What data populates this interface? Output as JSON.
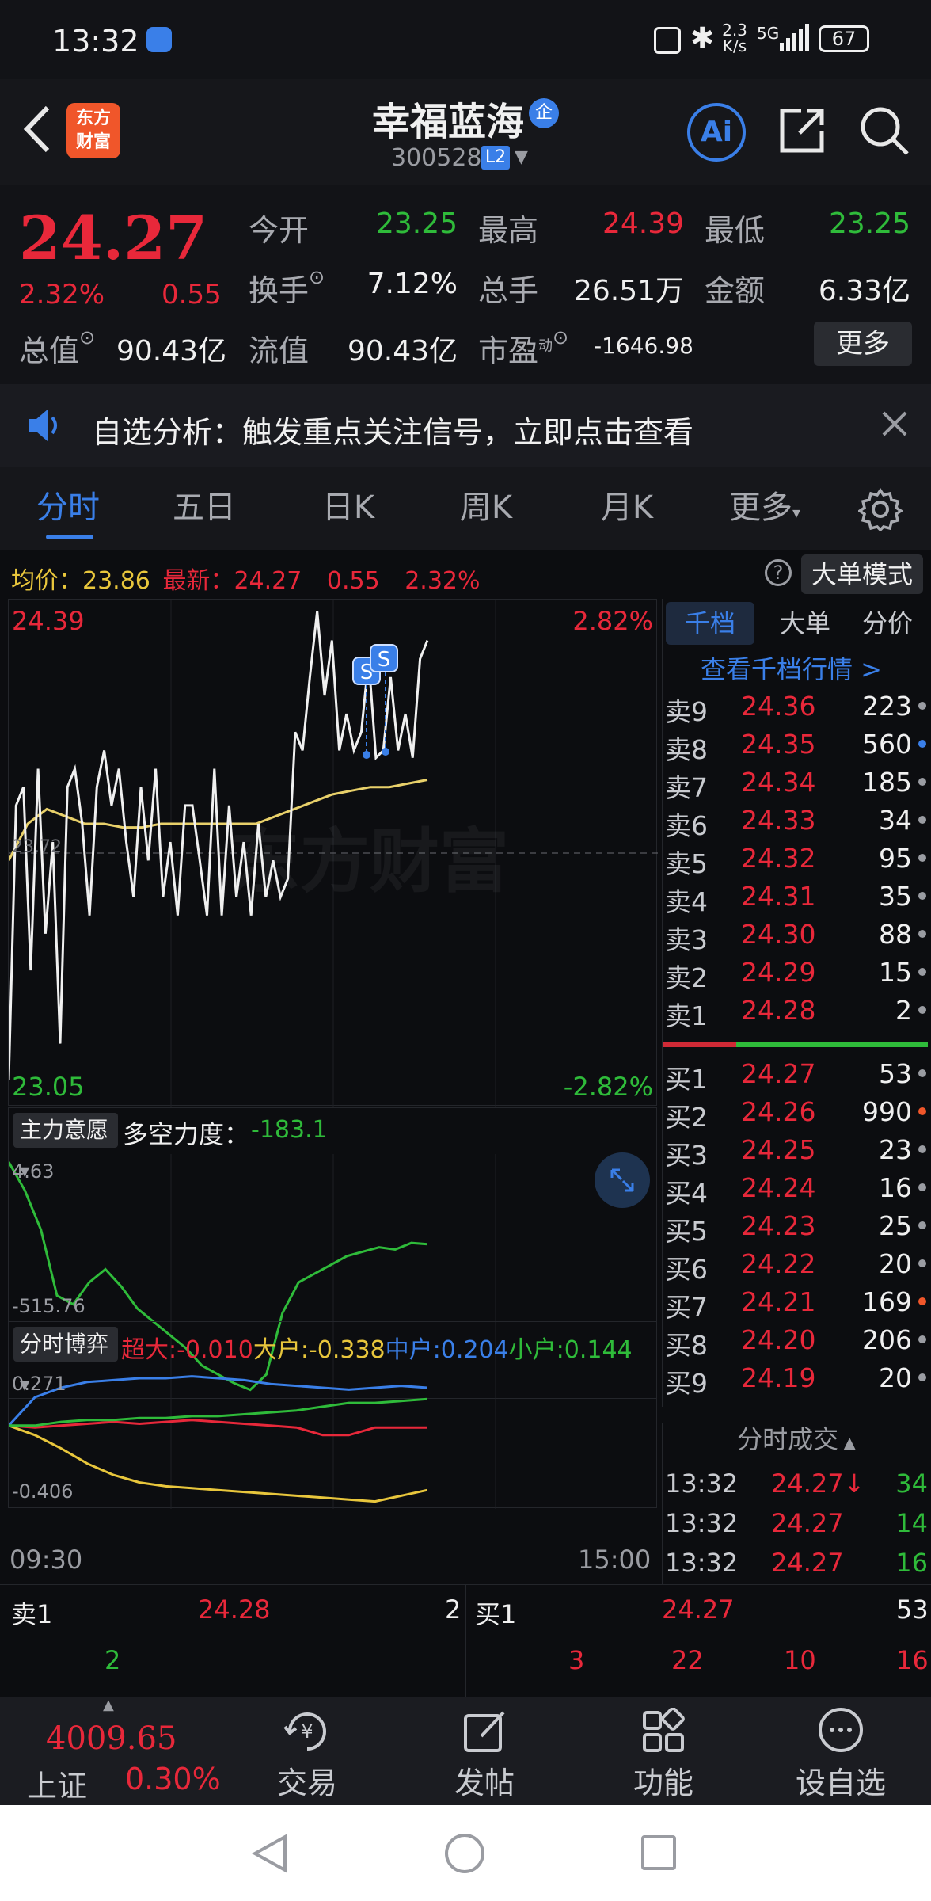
{
  "status": {
    "time": "13:32",
    "speed": "2.3",
    "speed_unit": "K/s",
    "network": "5G",
    "battery": "67"
  },
  "header": {
    "logo_line1": "东方",
    "logo_line2": "财富",
    "title": "幸福蓝海",
    "badge": "企",
    "code": "300528",
    "level": "L2",
    "ai": "Ai"
  },
  "quote": {
    "price": "24.27",
    "change_pct": "2.32%",
    "change": "0.55",
    "open_label": "今开",
    "open": "23.25",
    "high_label": "最高",
    "high": "24.39",
    "low_label": "最低",
    "low": "23.25",
    "turnover_label": "换手",
    "turnover": "7.12%",
    "volume_label": "总手",
    "volume": "26.51万",
    "amount_label": "金额",
    "amount": "6.33亿",
    "mktcap_label": "总值",
    "mktcap": "90.43亿",
    "float_label": "流值",
    "float": "90.43亿",
    "pe_label": "市盈",
    "pe_sup": "动",
    "pe": "-1646.98",
    "more": "更多"
  },
  "alert": {
    "text": "自选分析：触发重点关注信号，立即点击查看"
  },
  "tabs": [
    "分时",
    "五日",
    "日K",
    "周K",
    "月K",
    "更多"
  ],
  "chart_info": {
    "avg_label": "均价：",
    "avg": "23.86",
    "latest_label": "最新：",
    "latest": "24.27",
    "chg": "0.55",
    "pct": "2.32%",
    "mode_btn": "大单模式",
    "top_price": "24.39",
    "top_pct": "2.82%",
    "bottom_price": "23.05",
    "bottom_pct": "-2.82%",
    "mid_price": "23.72",
    "watermark": "东方财富"
  },
  "indicator1": {
    "select": "主力意愿",
    "label": "多空力度：",
    "value": "-183.1",
    "top": "4.63",
    "bottom": "-515.76"
  },
  "indicator2": {
    "select": "分时博弈",
    "xl_label": "超大",
    "xl": ":-0.010",
    "l_label": "大户",
    "l": ":-0.338",
    "m_label": "中户",
    "m": ":0.204",
    "s_label": "小户",
    "s": ":0.144",
    "top": "0.271",
    "bottom": "-0.406",
    "time_start": "09:30",
    "time_end": "15:00"
  },
  "chart_data": [
    {
      "type": "line",
      "title": "",
      "ylim": [
        23.05,
        24.39
      ],
      "x": [
        "09:30",
        "15:00"
      ],
      "series": [
        {
          "name": "",
          "values": [
            23.1,
            23.85,
            23.9,
            23.4,
            23.95,
            23.5,
            23.75,
            23.2,
            23.9,
            23.95,
            23.8,
            23.55,
            23.9,
            24.0,
            23.85,
            23.95,
            23.75,
            23.6,
            23.9,
            23.7,
            23.95,
            23.6,
            23.75,
            23.55,
            23.85,
            23.85,
            23.7,
            23.55,
            23.95,
            23.55,
            23.85,
            23.6,
            23.75,
            23.55,
            23.8,
            23.6,
            23.7,
            23.6,
            23.65,
            24.05,
            24.0,
            24.2,
            24.38,
            24.15,
            24.3,
            24.0,
            24.1,
            24.0,
            24.05,
            24.25,
            23.98,
            24.0,
            24.2,
            24.0,
            24.1,
            23.98,
            24.25,
            24.3
          ]
        },
        {
          "name": "",
          "values": [
            23.7,
            23.8,
            23.84,
            23.82,
            23.8,
            23.8,
            23.79,
            23.79,
            23.8,
            23.8,
            23.8,
            23.8,
            23.8,
            23.8,
            23.82,
            23.84,
            23.86,
            23.88,
            23.89,
            23.9,
            23.9,
            23.91,
            23.92
          ]
        }
      ]
    },
    {
      "type": "line",
      "title": "",
      "ylim": [
        -515.76,
        4.63
      ],
      "series": [
        {
          "name": "多空力度",
          "values": [
            4.63,
            -60,
            -150,
            -300,
            -320,
            -270,
            -240,
            -280,
            -330,
            -360,
            -390,
            -420,
            -460,
            -480,
            -500,
            -515,
            -480,
            -340,
            -270,
            -250,
            -230,
            -210,
            -200,
            -190,
            -195,
            -180,
            -183
          ]
        }
      ]
    },
    {
      "type": "line",
      "title": "",
      "ylim": [
        -0.406,
        0.271
      ],
      "series": [
        {
          "name": "超大",
          "values": [
            0.0,
            -0.01,
            0.0,
            0.01,
            0.02,
            0.01,
            0.02,
            0.03,
            0.02,
            0.01,
            0.0,
            -0.01,
            -0.05,
            -0.05,
            -0.01,
            -0.01,
            -0.01
          ]
        },
        {
          "name": "大户",
          "values": [
            0.0,
            -0.05,
            -0.12,
            -0.2,
            -0.26,
            -0.3,
            -0.32,
            -0.33,
            -0.34,
            -0.35,
            -0.36,
            -0.37,
            -0.38,
            -0.39,
            -0.4,
            -0.37,
            -0.34
          ]
        },
        {
          "name": "中户",
          "values": [
            0.0,
            0.15,
            0.2,
            0.23,
            0.24,
            0.25,
            0.25,
            0.26,
            0.25,
            0.24,
            0.22,
            0.21,
            0.2,
            0.19,
            0.2,
            0.21,
            0.2
          ]
        },
        {
          "name": "小户",
          "values": [
            0.0,
            0.0,
            0.02,
            0.03,
            0.03,
            0.04,
            0.04,
            0.05,
            0.05,
            0.06,
            0.07,
            0.08,
            0.1,
            0.12,
            0.12,
            0.13,
            0.14
          ]
        }
      ]
    }
  ],
  "orderbook": {
    "tabs": [
      "千档",
      "大单",
      "分价"
    ],
    "link": "查看千档行情 >",
    "asks": [
      {
        "l": "卖9",
        "p": "24.36",
        "v": "223"
      },
      {
        "l": "卖8",
        "p": "24.35",
        "v": "560"
      },
      {
        "l": "卖7",
        "p": "24.34",
        "v": "185"
      },
      {
        "l": "卖6",
        "p": "24.33",
        "v": "34"
      },
      {
        "l": "卖5",
        "p": "24.32",
        "v": "95"
      },
      {
        "l": "卖4",
        "p": "24.31",
        "v": "35"
      },
      {
        "l": "卖3",
        "p": "24.30",
        "v": "88"
      },
      {
        "l": "卖2",
        "p": "24.29",
        "v": "15"
      },
      {
        "l": "卖1",
        "p": "24.28",
        "v": "2"
      }
    ],
    "bids": [
      {
        "l": "买1",
        "p": "24.27",
        "v": "53"
      },
      {
        "l": "买2",
        "p": "24.26",
        "v": "990"
      },
      {
        "l": "买3",
        "p": "24.25",
        "v": "23"
      },
      {
        "l": "买4",
        "p": "24.24",
        "v": "16"
      },
      {
        "l": "买5",
        "p": "24.23",
        "v": "25"
      },
      {
        "l": "买6",
        "p": "24.22",
        "v": "20"
      },
      {
        "l": "买7",
        "p": "24.21",
        "v": "169"
      },
      {
        "l": "买8",
        "p": "24.20",
        "v": "206"
      },
      {
        "l": "买9",
        "p": "24.19",
        "v": "20"
      }
    ],
    "trades_title": "分时成交",
    "trades": [
      {
        "t": "13:32",
        "p": "24.27",
        "v": "34"
      },
      {
        "t": "13:32",
        "p": "24.27",
        "v": "14"
      },
      {
        "t": "13:32",
        "p": "24.27",
        "v": "16"
      }
    ]
  },
  "bottomquote": {
    "sell_label": "卖1",
    "sell_price": "24.28",
    "sell_vol": "2",
    "buy_label": "买1",
    "buy_price": "24.27",
    "buy_vol": "53",
    "row2": [
      "2",
      "3",
      "22",
      "10",
      "16"
    ]
  },
  "tabbar": {
    "index_value": "4009.65",
    "index_name": "上证",
    "index_pct": "0.30%",
    "trade": "交易",
    "post": "发帖",
    "func": "功能",
    "watch": "设自选"
  }
}
